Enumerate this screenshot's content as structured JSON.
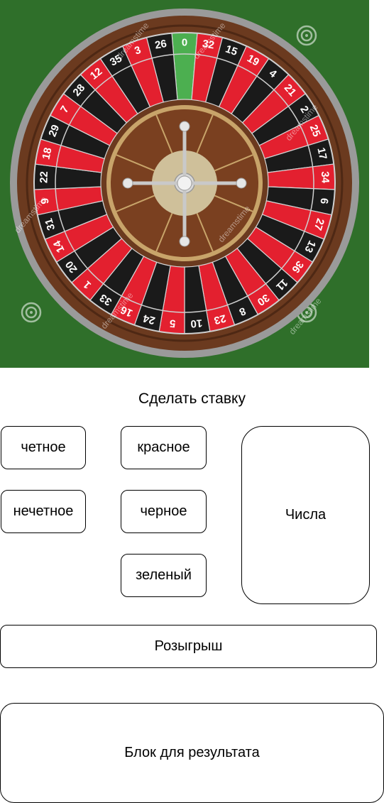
{
  "wheel": {
    "numbers": [
      "0",
      "32",
      "15",
      "19",
      "4",
      "21",
      "2",
      "25",
      "17",
      "34",
      "6",
      "27",
      "13",
      "36",
      "11",
      "30",
      "8",
      "23",
      "10",
      "5",
      "24",
      "16",
      "33",
      "1",
      "20",
      "14",
      "31",
      "9",
      "22",
      "18",
      "29",
      "7",
      "28",
      "12",
      "35",
      "3",
      "26"
    ],
    "watermark": "dreamstime",
    "colors": {
      "felt": "#2f6f2a",
      "red": "#e3202f",
      "black": "#1a1a1a",
      "green": "#4caf50",
      "wood": "#6b3a1f",
      "rim": "#9a9a9a"
    }
  },
  "bet": {
    "heading": "Сделать ставку",
    "even_label": "четное",
    "odd_label": "нечетное",
    "red_label": "красное",
    "black_label": "черное",
    "green_label": "зеленый",
    "numbers_label": "Числа"
  },
  "draw": {
    "button_label": "Розыгрыш"
  },
  "result": {
    "label": "Блок для результата"
  }
}
